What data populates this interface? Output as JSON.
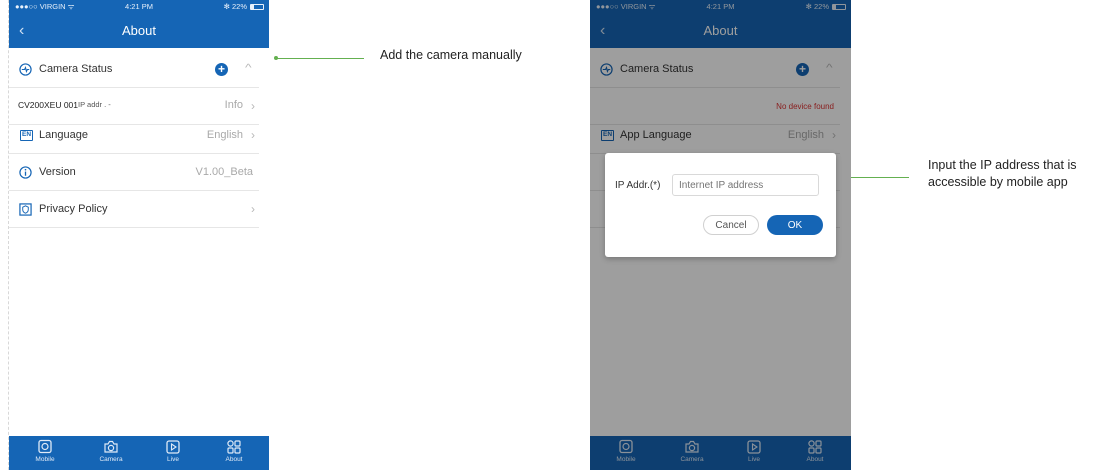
{
  "status_bar": {
    "carrier": "●●●○○ VIRGIN ᯤ",
    "time": "4:21 PM",
    "battery": "✻ 22%"
  },
  "screen1": {
    "nav_title": "About",
    "camera_status_label": "Camera Status",
    "camera_row": {
      "name": "CV200XEU 001",
      "ip": "IP addr . -",
      "info": "Info"
    },
    "language": {
      "label": "Language",
      "value": "English"
    },
    "version": {
      "label": "Version",
      "value": "V1.00_Beta"
    },
    "privacy": {
      "label": "Privacy Policy"
    }
  },
  "screen2": {
    "nav_title": "About",
    "camera_status_label": "Camera Status",
    "no_device": "No device found",
    "language": {
      "label": "App Language",
      "value": "English"
    },
    "dialog": {
      "label": "IP Addr.(*)",
      "placeholder": "Internet IP address",
      "cancel": "Cancel",
      "ok": "OK"
    }
  },
  "tabs": [
    {
      "label": "Mobile",
      "icon": "mobile-icon"
    },
    {
      "label": "Camera",
      "icon": "camera-icon"
    },
    {
      "label": "Live",
      "icon": "play-icon"
    },
    {
      "label": "About",
      "icon": "grid-icon"
    }
  ],
  "callouts": {
    "add_camera": "Add the camera manually",
    "ip_line1": "Input the IP address that is",
    "ip_line2": "accessible by mobile app"
  },
  "colors": {
    "brand_blue": "#1565b5",
    "callout_green": "#64b050",
    "error_red": "#dd3333"
  }
}
